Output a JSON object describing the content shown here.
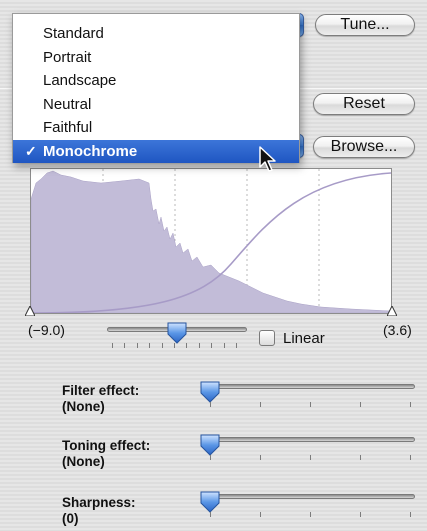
{
  "buttons": {
    "tune_label": "Tune...",
    "reset_label": "Reset",
    "browse_label": "Browse..."
  },
  "style_menu": {
    "items": [
      "Standard",
      "Portrait",
      "Landscape",
      "Neutral",
      "Faithful",
      "Monochrome"
    ],
    "selected_index": 5,
    "check_glyph": "✓"
  },
  "histogram": {
    "min_label": "(−9.0)",
    "max_label": "(3.6)",
    "slider_value_fraction": 0.5,
    "linear_label": "Linear",
    "linear_checked": false
  },
  "effects": {
    "filter_label": "Filter effect:",
    "filter_value": "(None)",
    "toning_label": "Toning effect:",
    "toning_value": "(None)",
    "sharpness_label": "Sharpness:",
    "sharpness_value": "(0)"
  },
  "colors": {
    "selection": "#2a63cf",
    "histogram_fill": "#c2bcd8",
    "curve": "#a79bc7"
  }
}
